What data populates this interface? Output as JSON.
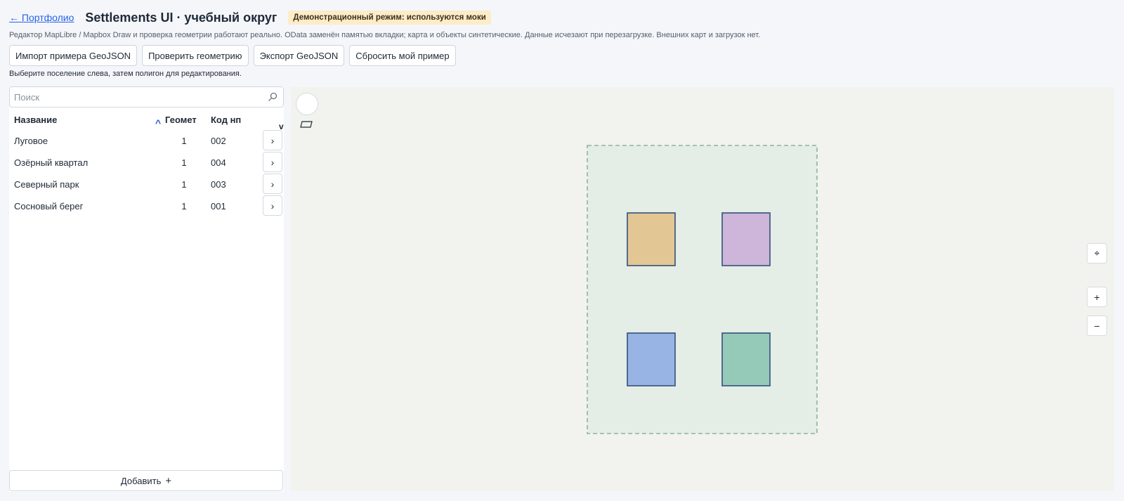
{
  "header": {
    "back_link": "← Портфолио",
    "title": "Settlements UI · учебный округ",
    "badge": "Демонстрационный режим: используются моки"
  },
  "subtitle": "Редактор MapLibre / Mapbox Draw и проверка геометрии работают реально. OData заменён памятью вкладки; карта и объекты синтетические. Данные исчезают при перезагрузке. Внешних карт и загрузок нет.",
  "toolbar": {
    "import_label": "Импорт примера GeoJSON",
    "validate_label": "Проверить геометрию",
    "export_label": "Экспорт GeoJSON",
    "reset_label": "Сбросить мой пример"
  },
  "hint": "Выберите поселение слева, затем полигон для редактирования.",
  "search": {
    "placeholder": "Поиск",
    "value": "",
    "icon": "search-icon"
  },
  "table": {
    "columns": {
      "name": "Название",
      "geom": "Геомет",
      "code": "Код нп"
    },
    "sort_asc_glyph": "^",
    "sort_desc_glyph": "v",
    "rows": [
      {
        "name": "Луговое",
        "geom_count": "1",
        "code": "002",
        "open_glyph": "›"
      },
      {
        "name": "Озёрный квартал",
        "geom_count": "1",
        "code": "004",
        "open_glyph": "›"
      },
      {
        "name": "Северный парк",
        "geom_count": "1",
        "code": "003",
        "open_glyph": "›"
      },
      {
        "name": "Сосновый берег",
        "geom_count": "1",
        "code": "001",
        "open_glyph": "›"
      }
    ]
  },
  "add_button": {
    "label": "Добавить",
    "plus": "+"
  },
  "map": {
    "boundary_color": "#8fb39a",
    "boundary_fill": "#e4ede6",
    "polygons": [
      {
        "fill": "#e2c694",
        "stroke": "#34507a"
      },
      {
        "fill": "#cdb6d9",
        "stroke": "#34507a"
      },
      {
        "fill": "#98b4e5",
        "stroke": "#34507a"
      },
      {
        "fill": "#96cab8",
        "stroke": "#34507a"
      }
    ],
    "controls": {
      "compass": "⌖",
      "zoom_in": "+",
      "zoom_out": "−"
    }
  }
}
